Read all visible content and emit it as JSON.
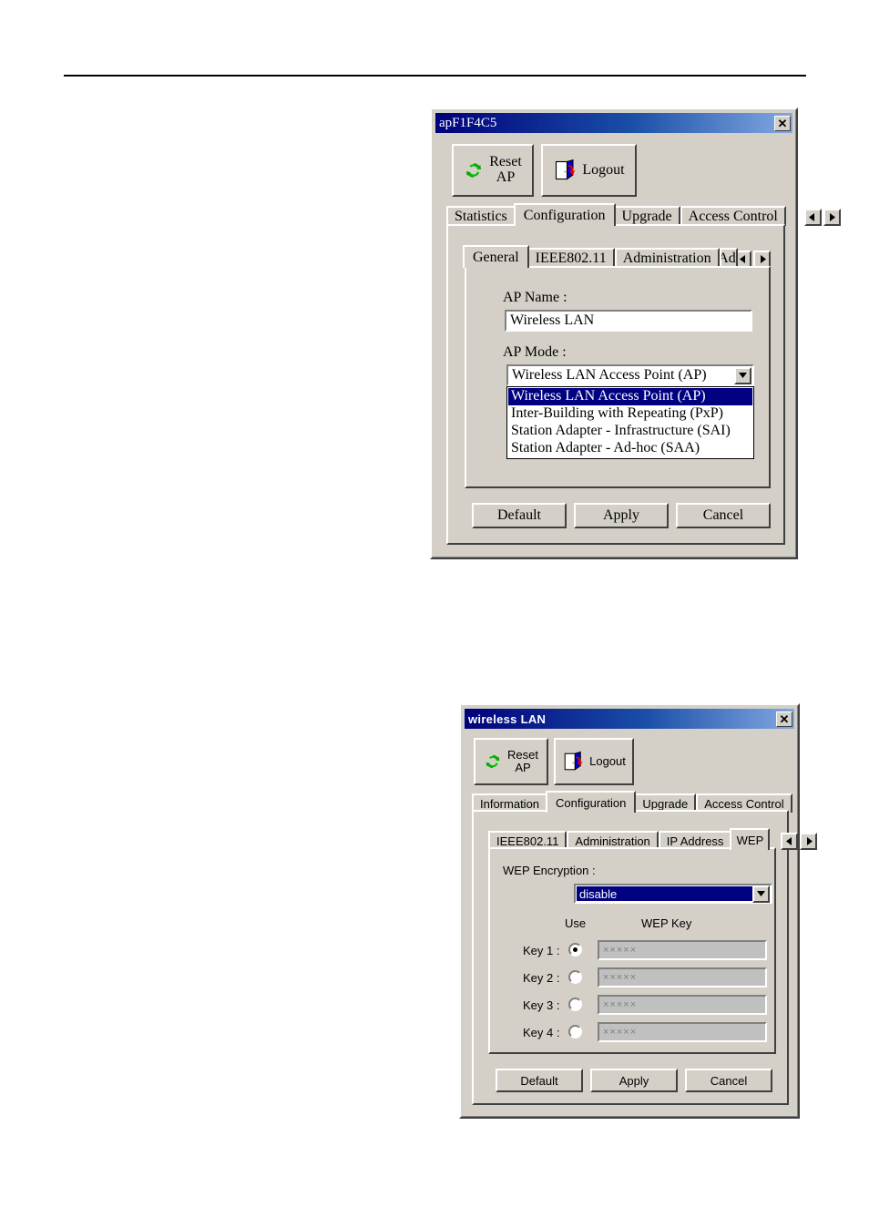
{
  "page": {
    "background": "#ffffff",
    "rule_color": "#000000"
  },
  "dialog1": {
    "title": "apF1F4C5",
    "close_label": "✕",
    "toolbar": {
      "reset_label": "Reset\nAP",
      "reset_icon": "refresh-icon",
      "logout_label": "Logout",
      "logout_icon": "door-exit-icon"
    },
    "outer_tabs": {
      "items": [
        {
          "label": "Statistics",
          "selected": false
        },
        {
          "label": "Configuration",
          "selected": true
        },
        {
          "label": "Upgrade",
          "selected": false
        },
        {
          "label": "Access Control",
          "selected": false
        }
      ],
      "scroll_left": "◄",
      "scroll_right": "►"
    },
    "inner_tabs": {
      "items": [
        {
          "label": "General",
          "selected": true
        },
        {
          "label": "IEEE802.11",
          "selected": false
        },
        {
          "label": "Administration",
          "selected": false
        },
        {
          "label": "IP Addre",
          "selected": false
        }
      ],
      "scroll_left": "◄",
      "scroll_right": "►"
    },
    "form": {
      "ap_name_label": "AP Name :",
      "ap_name_value": "Wireless LAN",
      "ap_mode_label": "AP Mode :",
      "ap_mode_value": "Wireless LAN Access Point (AP)",
      "ap_mode_options": [
        "Wireless LAN Access Point (AP)",
        "Inter-Building with Repeating (PxP)",
        "Station Adapter - Infrastructure (SAI)",
        "Station Adapter - Ad-hoc (SAA)"
      ],
      "ap_mode_selected_index": 0,
      "dropdown_arrow": "▼",
      "highlight_color": "#000080"
    },
    "buttons": {
      "default_label": "Default",
      "apply_label": "Apply",
      "cancel_label": "Cancel"
    }
  },
  "dialog2": {
    "title": "wireless LAN",
    "close_label": "✕",
    "toolbar": {
      "reset_label": "Reset\nAP",
      "reset_icon": "refresh-icon",
      "logout_label": "Logout",
      "logout_icon": "door-exit-icon"
    },
    "outer_tabs": {
      "items": [
        {
          "label": "Information",
          "selected": false
        },
        {
          "label": "Configuration",
          "selected": true
        },
        {
          "label": "Upgrade",
          "selected": false
        },
        {
          "label": "Access Control",
          "selected": false
        }
      ]
    },
    "inner_tabs": {
      "items": [
        {
          "label": "IEEE802.11",
          "selected": false
        },
        {
          "label": "Administration",
          "selected": false
        },
        {
          "label": "IP Address",
          "selected": false
        },
        {
          "label": "WEP",
          "selected": true
        }
      ],
      "scroll_left": "◄",
      "scroll_right": "►"
    },
    "form": {
      "encryption_label": "WEP Encryption :",
      "encryption_value": "disable",
      "encryption_options": [
        "disable"
      ],
      "dropdown_arrow": "▼",
      "highlight_color": "#000080",
      "col_use_header": "Use",
      "col_key_header": "WEP Key",
      "keys": [
        {
          "label": "Key 1 :",
          "selected": true,
          "value": "×××××"
        },
        {
          "label": "Key 2 :",
          "selected": false,
          "value": "×××××"
        },
        {
          "label": "Key 3 :",
          "selected": false,
          "value": "×××××"
        },
        {
          "label": "Key 4 :",
          "selected": false,
          "value": "×××××"
        }
      ]
    },
    "buttons": {
      "default_label": "Default",
      "apply_label": "Apply",
      "cancel_label": "Cancel"
    }
  }
}
